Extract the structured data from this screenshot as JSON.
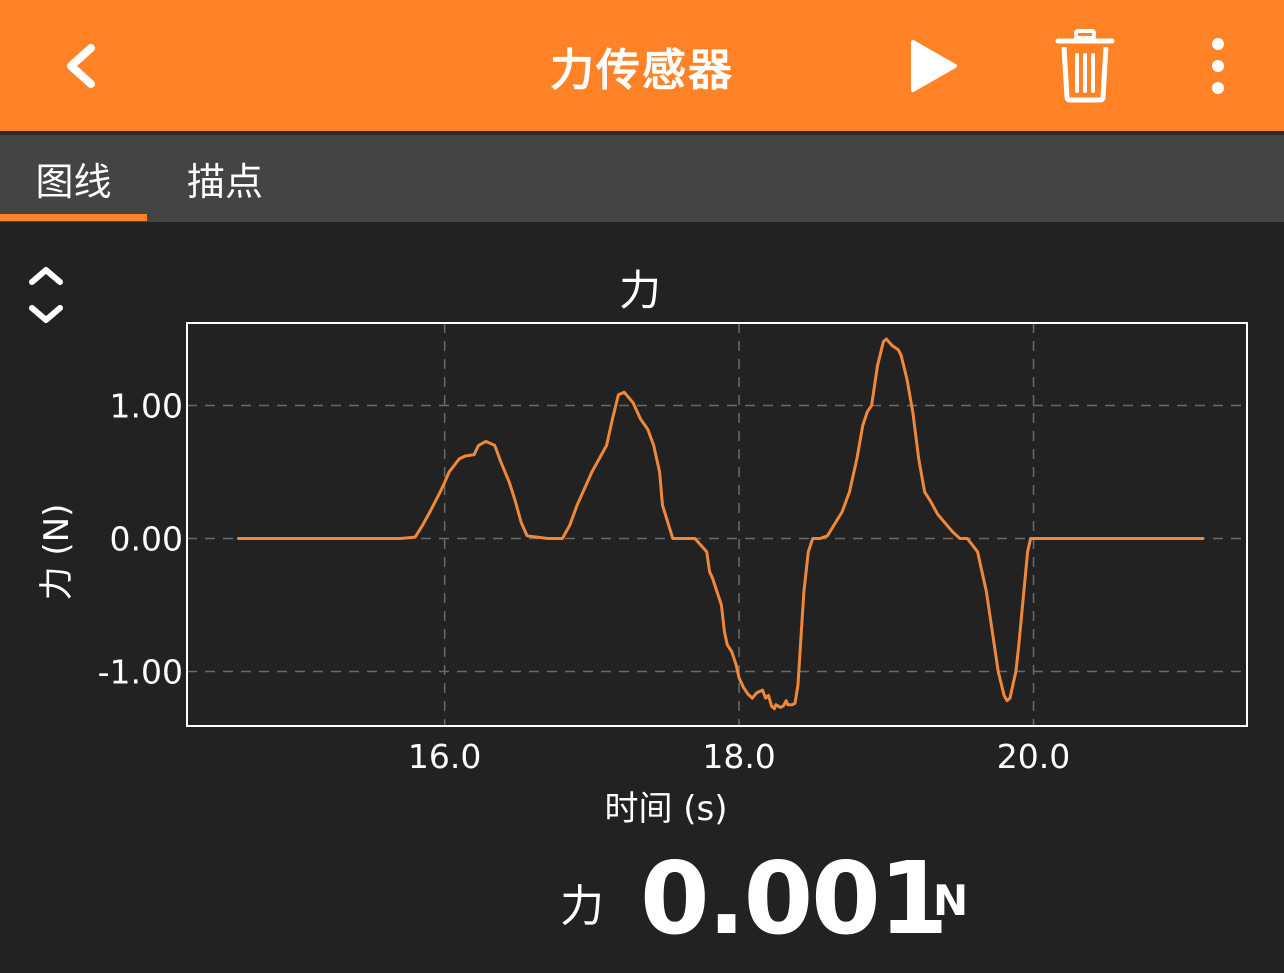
{
  "appbar": {
    "title": "力传感器",
    "back_icon": "chevron-left-icon",
    "play_icon": "play-icon",
    "trash_icon": "trash-icon",
    "more_icon": "more-vertical-icon",
    "color": "#FF8326"
  },
  "tabs": [
    {
      "label": "图线",
      "selected": true
    },
    {
      "label": "描点",
      "selected": false
    }
  ],
  "expand_icon": "expand-collapse-icon",
  "chart_data": {
    "type": "line",
    "title": "力",
    "xlabel": "时间 (s)",
    "ylabel": "力 (N)",
    "xlim": [
      14.25,
      21.45
    ],
    "ylim": [
      -1.41,
      1.62
    ],
    "xticks": [
      16.0,
      18.0,
      20.0
    ],
    "xtick_labels": [
      "16.0",
      "18.0",
      "20.0"
    ],
    "yticks": [
      1.0,
      0.0,
      -1.0
    ],
    "ytick_labels": [
      "1.00",
      "0.00",
      "-1.00"
    ],
    "grid": true,
    "line_color": "#F0883A",
    "series": [
      {
        "x": [
          14.6,
          15.0,
          15.4,
          15.7,
          15.8,
          15.85,
          15.9,
          15.97,
          16.0,
          16.03,
          16.1,
          16.14,
          16.2,
          16.23,
          16.28,
          16.34,
          16.38,
          16.44,
          16.48,
          16.52,
          16.56,
          16.7,
          16.76,
          16.8,
          16.85,
          16.9,
          17.0,
          17.1,
          17.14,
          17.18,
          17.22,
          17.28,
          17.33,
          17.38,
          17.42,
          17.46,
          17.48,
          17.55,
          17.65,
          17.7,
          17.78,
          17.8,
          17.82,
          17.88,
          17.9,
          17.92,
          17.95,
          17.98,
          18.0,
          18.03,
          18.06,
          18.09,
          18.12,
          18.14,
          18.16,
          18.18,
          18.2,
          18.22,
          18.24,
          18.25,
          18.28,
          18.3,
          18.32,
          18.33,
          18.36,
          18.38,
          18.4,
          18.42,
          18.44,
          18.47,
          18.5,
          18.55,
          18.6,
          18.7,
          18.75,
          18.8,
          18.84,
          18.87,
          18.9,
          18.94,
          18.98,
          19.0,
          19.04,
          19.08,
          19.1,
          19.14,
          19.18,
          19.22,
          19.26,
          19.3,
          19.35,
          19.45,
          19.5,
          19.55,
          19.62,
          19.64,
          19.68,
          19.72,
          19.76,
          19.8,
          19.82,
          19.84,
          19.86,
          19.88,
          19.9,
          19.93,
          19.96,
          19.98,
          20.0,
          20.02,
          20.1,
          20.5,
          21.0,
          21.15
        ],
        "y": [
          0,
          0,
          0,
          0,
          0.01,
          0.1,
          0.2,
          0.35,
          0.42,
          0.5,
          0.6,
          0.62,
          0.63,
          0.7,
          0.73,
          0.7,
          0.58,
          0.42,
          0.28,
          0.12,
          0.02,
          0,
          0,
          0,
          0.1,
          0.25,
          0.5,
          0.7,
          0.9,
          1.08,
          1.1,
          1.02,
          0.9,
          0.82,
          0.7,
          0.5,
          0.25,
          0,
          0,
          0,
          -0.1,
          -0.25,
          -0.3,
          -0.5,
          -0.7,
          -0.8,
          -0.85,
          -0.95,
          -1.05,
          -1.12,
          -1.17,
          -1.2,
          -1.16,
          -1.15,
          -1.14,
          -1.2,
          -1.18,
          -1.26,
          -1.28,
          -1.25,
          -1.27,
          -1.26,
          -1.22,
          -1.25,
          -1.25,
          -1.24,
          -1.1,
          -0.75,
          -0.4,
          -0.1,
          0,
          0,
          0.02,
          0.2,
          0.35,
          0.6,
          0.85,
          0.95,
          1.0,
          1.3,
          1.48,
          1.5,
          1.45,
          1.42,
          1.38,
          1.2,
          0.95,
          0.6,
          0.35,
          0.28,
          0.18,
          0.05,
          0,
          0,
          -0.1,
          -0.2,
          -0.4,
          -0.7,
          -1.0,
          -1.18,
          -1.22,
          -1.2,
          -1.1,
          -1.0,
          -0.8,
          -0.45,
          -0.1,
          0,
          0,
          0,
          0,
          0,
          0,
          0
        ]
      }
    ]
  },
  "reading": {
    "label": "力",
    "value": "0.001",
    "unit": "N"
  }
}
